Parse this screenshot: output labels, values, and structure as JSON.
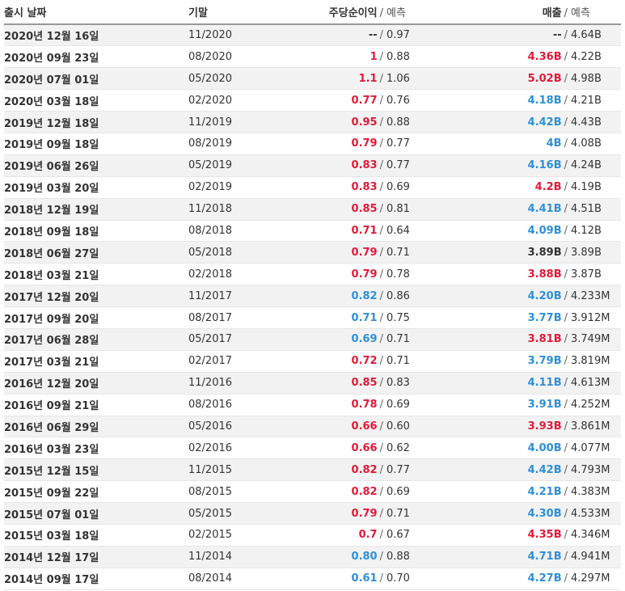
{
  "colors": {
    "beat": "#e31937",
    "miss": "#2e8fd8",
    "neutral": "#333333"
  },
  "header": {
    "date": "출시 날짜",
    "period": "기말",
    "eps": "주당순이익",
    "eps_forecast": "예측",
    "revenue": "매출",
    "revenue_forecast": "예측",
    "separator": "/"
  },
  "rows": [
    {
      "date": "2020년 12월 16일",
      "period": "11/2020",
      "eps": "--",
      "eps_status": "neu",
      "eps_fc": "0.97",
      "rev": "--",
      "rev_status": "neu",
      "rev_fc": "4.64B"
    },
    {
      "date": "2020년 09월 23일",
      "period": "08/2020",
      "eps": "1",
      "eps_status": "pos",
      "eps_fc": "0.88",
      "rev": "4.36B",
      "rev_status": "pos",
      "rev_fc": "4.22B"
    },
    {
      "date": "2020년 07월 01일",
      "period": "05/2020",
      "eps": "1.1",
      "eps_status": "pos",
      "eps_fc": "1.06",
      "rev": "5.02B",
      "rev_status": "pos",
      "rev_fc": "4.98B"
    },
    {
      "date": "2020년 03월 18일",
      "period": "02/2020",
      "eps": "0.77",
      "eps_status": "pos",
      "eps_fc": "0.76",
      "rev": "4.18B",
      "rev_status": "neg",
      "rev_fc": "4.21B"
    },
    {
      "date": "2019년 12월 18일",
      "period": "11/2019",
      "eps": "0.95",
      "eps_status": "pos",
      "eps_fc": "0.88",
      "rev": "4.42B",
      "rev_status": "neg",
      "rev_fc": "4.43B"
    },
    {
      "date": "2019년 09월 18일",
      "period": "08/2019",
      "eps": "0.79",
      "eps_status": "pos",
      "eps_fc": "0.77",
      "rev": "4B",
      "rev_status": "neg",
      "rev_fc": "4.08B"
    },
    {
      "date": "2019년 06월 26일",
      "period": "05/2019",
      "eps": "0.83",
      "eps_status": "pos",
      "eps_fc": "0.77",
      "rev": "4.16B",
      "rev_status": "neg",
      "rev_fc": "4.24B"
    },
    {
      "date": "2019년 03월 20일",
      "period": "02/2019",
      "eps": "0.83",
      "eps_status": "pos",
      "eps_fc": "0.69",
      "rev": "4.2B",
      "rev_status": "pos",
      "rev_fc": "4.19B"
    },
    {
      "date": "2018년 12월 19일",
      "period": "11/2018",
      "eps": "0.85",
      "eps_status": "pos",
      "eps_fc": "0.81",
      "rev": "4.41B",
      "rev_status": "neg",
      "rev_fc": "4.51B"
    },
    {
      "date": "2018년 09월 18일",
      "period": "08/2018",
      "eps": "0.71",
      "eps_status": "pos",
      "eps_fc": "0.64",
      "rev": "4.09B",
      "rev_status": "neg",
      "rev_fc": "4.12B"
    },
    {
      "date": "2018년 06월 27일",
      "period": "05/2018",
      "eps": "0.79",
      "eps_status": "pos",
      "eps_fc": "0.71",
      "rev": "3.89B",
      "rev_status": "neu",
      "rev_fc": "3.89B"
    },
    {
      "date": "2018년 03월 21일",
      "period": "02/2018",
      "eps": "0.79",
      "eps_status": "pos",
      "eps_fc": "0.78",
      "rev": "3.88B",
      "rev_status": "pos",
      "rev_fc": "3.87B"
    },
    {
      "date": "2017년 12월 20일",
      "period": "11/2017",
      "eps": "0.82",
      "eps_status": "neg",
      "eps_fc": "0.86",
      "rev": "4.20B",
      "rev_status": "neg",
      "rev_fc": "4.233M"
    },
    {
      "date": "2017년 09월 20일",
      "period": "08/2017",
      "eps": "0.71",
      "eps_status": "neg",
      "eps_fc": "0.75",
      "rev": "3.77B",
      "rev_status": "neg",
      "rev_fc": "3.912M"
    },
    {
      "date": "2017년 06월 28일",
      "period": "05/2017",
      "eps": "0.69",
      "eps_status": "neg",
      "eps_fc": "0.71",
      "rev": "3.81B",
      "rev_status": "pos",
      "rev_fc": "3.749M"
    },
    {
      "date": "2017년 03월 21일",
      "period": "02/2017",
      "eps": "0.72",
      "eps_status": "pos",
      "eps_fc": "0.71",
      "rev": "3.79B",
      "rev_status": "neg",
      "rev_fc": "3.819M"
    },
    {
      "date": "2016년 12월 20일",
      "period": "11/2016",
      "eps": "0.85",
      "eps_status": "pos",
      "eps_fc": "0.83",
      "rev": "4.11B",
      "rev_status": "neg",
      "rev_fc": "4.613M"
    },
    {
      "date": "2016년 09월 21일",
      "period": "08/2016",
      "eps": "0.78",
      "eps_status": "pos",
      "eps_fc": "0.69",
      "rev": "3.91B",
      "rev_status": "neg",
      "rev_fc": "4.252M"
    },
    {
      "date": "2016년 06월 29일",
      "period": "05/2016",
      "eps": "0.66",
      "eps_status": "pos",
      "eps_fc": "0.60",
      "rev": "3.93B",
      "rev_status": "pos",
      "rev_fc": "3.861M"
    },
    {
      "date": "2016년 03월 23일",
      "period": "02/2016",
      "eps": "0.66",
      "eps_status": "pos",
      "eps_fc": "0.62",
      "rev": "4.00B",
      "rev_status": "neg",
      "rev_fc": "4.077M"
    },
    {
      "date": "2015년 12월 15일",
      "period": "11/2015",
      "eps": "0.82",
      "eps_status": "pos",
      "eps_fc": "0.77",
      "rev": "4.42B",
      "rev_status": "neg",
      "rev_fc": "4.793M"
    },
    {
      "date": "2015년 09월 22일",
      "period": "08/2015",
      "eps": "0.82",
      "eps_status": "pos",
      "eps_fc": "0.69",
      "rev": "4.21B",
      "rev_status": "neg",
      "rev_fc": "4.383M"
    },
    {
      "date": "2015년 07월 01일",
      "period": "05/2015",
      "eps": "0.79",
      "eps_status": "pos",
      "eps_fc": "0.71",
      "rev": "4.30B",
      "rev_status": "neg",
      "rev_fc": "4.533M"
    },
    {
      "date": "2015년 03월 18일",
      "period": "02/2015",
      "eps": "0.7",
      "eps_status": "pos",
      "eps_fc": "0.67",
      "rev": "4.35B",
      "rev_status": "pos",
      "rev_fc": "4.346M"
    },
    {
      "date": "2014년 12월 17일",
      "period": "11/2014",
      "eps": "0.80",
      "eps_status": "neg",
      "eps_fc": "0.88",
      "rev": "4.71B",
      "rev_status": "neg",
      "rev_fc": "4.941M"
    },
    {
      "date": "2014년 09월 17일",
      "period": "08/2014",
      "eps": "0.61",
      "eps_status": "neg",
      "eps_fc": "0.70",
      "rev": "4.27B",
      "rev_status": "neg",
      "rev_fc": "4.297M"
    }
  ]
}
